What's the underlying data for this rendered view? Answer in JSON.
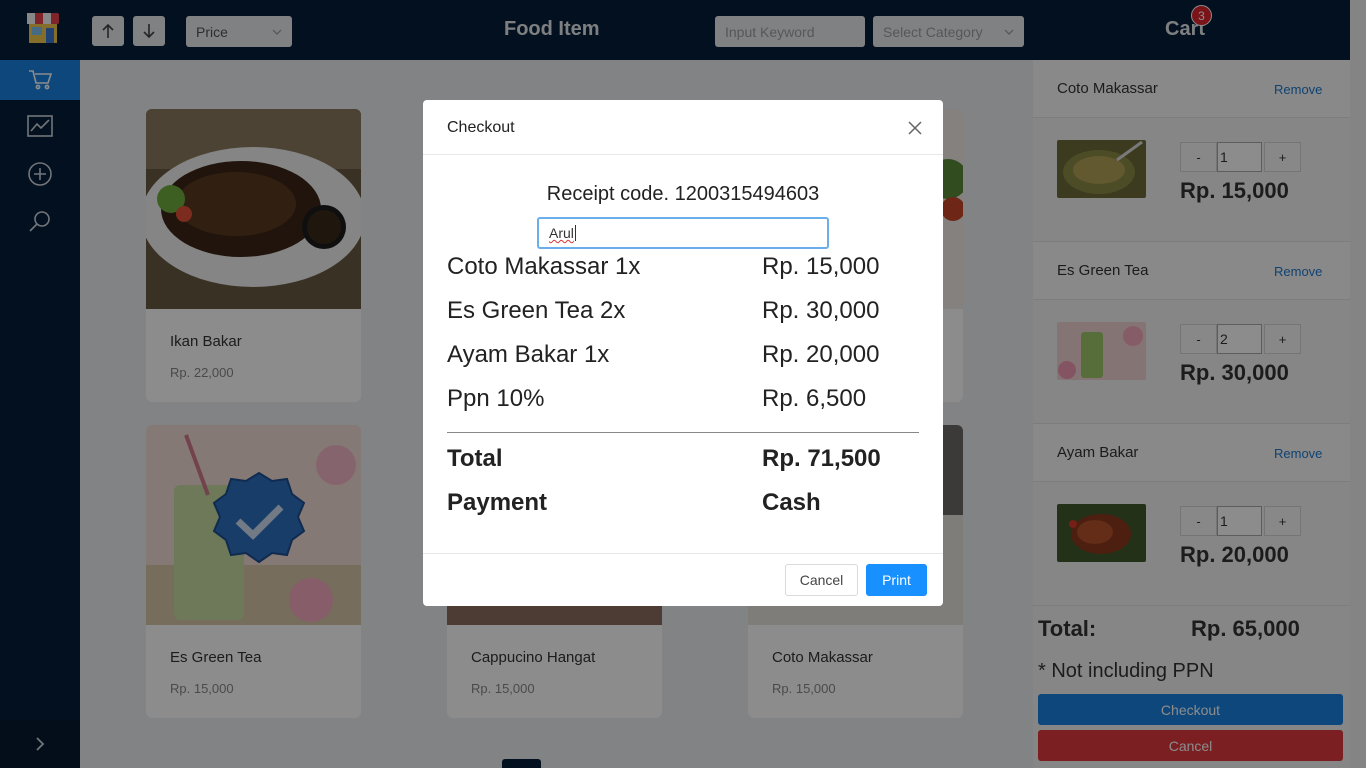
{
  "header": {
    "sort_up_icon": "arrow-up-icon",
    "sort_down_icon": "arrow-down-icon",
    "sort_select": "Price",
    "title": "Food Item",
    "search_placeholder": "Input Keyword",
    "category_placeholder": "Select Category",
    "cart_label": "Cart",
    "cart_count": "3"
  },
  "sidebar": {
    "items": [
      {
        "icon": "cart-icon",
        "active": true
      },
      {
        "icon": "chart-icon",
        "active": false
      },
      {
        "icon": "plus-circle-icon",
        "active": false
      },
      {
        "icon": "search-icon",
        "active": false
      }
    ],
    "expand_icon": "chevron-right-icon"
  },
  "products": [
    {
      "name": "Ikan Bakar",
      "price": "Rp. 22,000"
    },
    {
      "name": "",
      "price": ""
    },
    {
      "name": "",
      "price": ""
    },
    {
      "name": "Es Green Tea",
      "price": "Rp. 15,000"
    },
    {
      "name": "Cappucino Hangat",
      "price": "Rp. 15,000"
    },
    {
      "name": "Coto Makassar",
      "price": "Rp. 15,000"
    }
  ],
  "cart": {
    "remove_label": "Remove",
    "minus": "-",
    "plus": "+",
    "items": [
      {
        "name": "Coto Makassar",
        "qty": "1",
        "price": "Rp. 15,000"
      },
      {
        "name": "Es Green Tea",
        "qty": "2",
        "price": "Rp. 30,000"
      },
      {
        "name": "Ayam Bakar",
        "qty": "1",
        "price": "Rp. 20,000"
      }
    ],
    "total_label": "Total:",
    "total_value": "Rp. 65,000",
    "note": "* Not including PPN",
    "checkout_label": "Checkout",
    "cancel_label": "Cancel"
  },
  "modal": {
    "title": "Checkout",
    "close_icon": "close-icon",
    "receipt": "Receipt code. 1200315494603",
    "name_value": "Arul",
    "rows": [
      {
        "label": "Coto Makassar 1x",
        "value": "Rp. 15,000"
      },
      {
        "label": "Es Green Tea 2x",
        "value": "Rp. 30,000"
      },
      {
        "label": "Ayam Bakar 1x",
        "value": "Rp. 20,000"
      },
      {
        "label": "Ppn 10%",
        "value": "Rp. 6,500"
      }
    ],
    "total_label": "Total",
    "total_value": "Rp. 71,500",
    "payment_label": "Payment",
    "payment_value": "Cash",
    "cancel_label": "Cancel",
    "print_label": "Print"
  },
  "colors": {
    "navy": "#061e3a",
    "accent": "#1b82e2",
    "danger": "#e0393f",
    "print": "#1890ff"
  }
}
